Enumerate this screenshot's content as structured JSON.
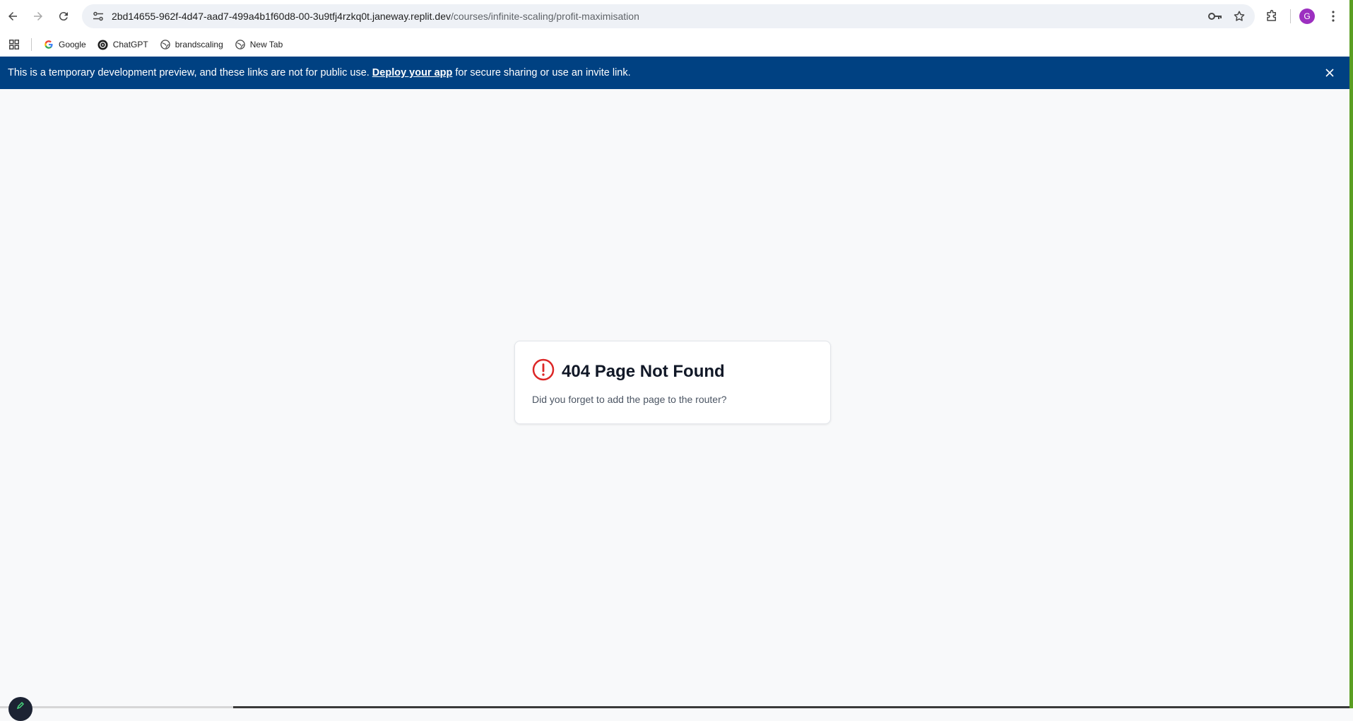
{
  "browser": {
    "url_host": "2bd14655-962f-4d47-aad7-499a4b1f60d8-00-3u9tfj4rzkq0t.janeway.replit.dev",
    "url_path": "/courses/infinite-scaling/profit-maximisation",
    "profile_initial": "G"
  },
  "bookmarks": [
    {
      "label": "Google",
      "icon": "google-icon"
    },
    {
      "label": "ChatGPT",
      "icon": "chatgpt-icon"
    },
    {
      "label": "brandscaling",
      "icon": "globe-icon"
    },
    {
      "label": "New Tab",
      "icon": "globe-icon"
    }
  ],
  "banner": {
    "text_before": "This is a temporary development preview, and these links are not for public use.",
    "link_text": "Deploy your app",
    "text_after": "for secure sharing or use an invite link.",
    "background_color": "#004182"
  },
  "error_card": {
    "title": "404 Page Not Found",
    "message": "Did you forget to add the page to the router?",
    "icon": "alert-circle-icon",
    "icon_color": "#dc2626"
  }
}
